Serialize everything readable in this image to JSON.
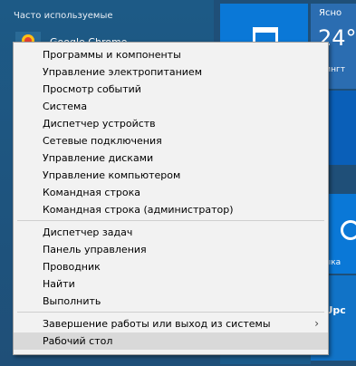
{
  "start": {
    "frequent_header": "Часто используемые",
    "first_app_partial": "Google Chrome",
    "weather": {
      "label": "Ясно",
      "temp": "24°",
      "city": "шингт"
    },
    "music_label": "узыка",
    "edge_label": "eUpc"
  },
  "menu": {
    "group1": [
      "Программы и компоненты",
      "Управление электропитанием",
      "Просмотр событий",
      "Система",
      "Диспетчер устройств",
      "Сетевые подключения",
      "Управление дисками",
      "Управление компьютером",
      "Командная строка",
      "Командная строка (администратор)"
    ],
    "group2": [
      "Диспетчер задач",
      "Панель управления",
      "Проводник",
      "Найти",
      "Выполнить"
    ],
    "shutdown": "Завершение работы или выход из системы",
    "desktop": "Рабочий стол",
    "submenu_arrow": "›"
  },
  "colors": {
    "tile_blue": "#0a78d7",
    "menu_bg": "#f2f2f2",
    "menu_hover": "#d9d9d9"
  }
}
